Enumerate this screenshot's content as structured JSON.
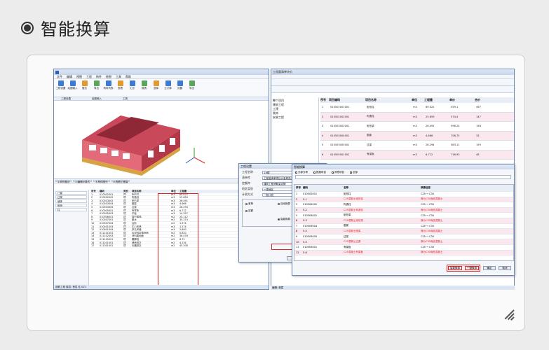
{
  "header": {
    "title": "智能换算"
  },
  "left_window": {
    "menu": [
      "文件",
      "编辑",
      "视图",
      "工程",
      "构件",
      "绘图",
      "工具",
      "帮助"
    ],
    "ribbon": [
      "工程设置",
      "绘图输入",
      "做法",
      "导出",
      "构件列表",
      "查看",
      "汇总",
      "报表",
      "选择",
      "云计算",
      "设置",
      "导出"
    ],
    "groups": [
      "工程设置",
      "绘图输入",
      "工具"
    ],
    "tabs": [
      "1.构件做法",
      "2.编辑计算式",
      "3.构件图元",
      "4.查看工程量"
    ],
    "tree": [
      "门窗",
      "过梁",
      "墙体",
      "砌块",
      "柱"
    ],
    "grid_header": [
      "序号",
      "编码",
      "类别",
      "项目名称",
      "单位",
      "工程量"
    ],
    "grid_rows": [
      [
        "1",
        "010502001",
        "项",
        "矩形柱",
        "m3",
        "89.022"
      ],
      [
        "2",
        "010502002",
        "项",
        "构造柱",
        "m3",
        "25.659"
      ],
      [
        "3",
        "010503002",
        "项",
        "矩形梁",
        "m3",
        "26.491"
      ],
      [
        "4",
        "010503004",
        "项",
        "圈梁",
        "m3",
        "4.666"
      ],
      [
        "5",
        "010503005",
        "项",
        "过梁",
        "m3",
        "28.294"
      ],
      [
        "6",
        "010505001",
        "项",
        "有梁板",
        "m3",
        "6.712"
      ],
      [
        "7",
        "010505003",
        "项",
        "平板",
        "m3",
        "14.357"
      ],
      [
        "8",
        "010506001",
        "项",
        "直形楼梯",
        "m2",
        "20.112"
      ],
      [
        "9",
        "010507001",
        "项",
        "散水",
        "m2",
        "35.274"
      ],
      [
        "10",
        "010507004",
        "项",
        "台阶",
        "m2",
        "1.574"
      ],
      [
        "11",
        "010401003",
        "项",
        "实心砖墙",
        "m3",
        "1.274"
      ],
      [
        "12",
        "010401004",
        "项",
        "多孔砖墙",
        "m3",
        "2.600"
      ],
      [
        "13",
        "011101001",
        "项",
        "水泥砂浆楼地面",
        "m2",
        "0.820"
      ],
      [
        "14",
        "011102003",
        "项",
        "块料楼地面",
        "m2",
        "36.476"
      ],
      [
        "15",
        "011105001",
        "项",
        "踢脚线",
        "m2",
        "8.72"
      ],
      [
        "16",
        "011201001",
        "项",
        "墙面抹灰",
        "m2",
        "4.134"
      ],
      [
        "17",
        "011301001",
        "项",
        "天棚抹灰",
        "m2",
        "45.208"
      ]
    ],
    "status": "钢筋工程 楼层: 首层  柱  KZ1"
  },
  "right_window": {
    "title": "工程量清单计价",
    "tree": [
      "整个项目",
      "建筑工程",
      "土建",
      "装饰",
      "安装工程"
    ],
    "grid_header": [
      "序号",
      "项目编码",
      "项目名称",
      "单位",
      "工程量",
      "单价",
      "合价"
    ],
    "grid_rows": [
      [
        "1",
        "010502001001",
        "矩形柱",
        "m3",
        "89.022",
        "559.1",
        "497"
      ],
      [
        "2",
        "010502002001",
        "构造柱",
        "m3",
        "25.659",
        "574.4",
        "147"
      ],
      [
        "3",
        "010503002001",
        "矩形梁",
        "m3",
        "26.491",
        "596.24",
        "158"
      ],
      [
        "4",
        "010503004001",
        "圈梁",
        "m3",
        "4.666",
        "708.75",
        "33"
      ],
      [
        "5",
        "010503005001",
        "过梁",
        "m3",
        "28.294",
        "563.11",
        "159"
      ],
      [
        "6",
        "010505001001",
        "有梁板",
        "m3",
        "6.712",
        "716.93",
        "48"
      ]
    ],
    "status": "编辑: 首层"
  },
  "dialog_1": {
    "title": "工程设置",
    "fields": [
      {
        "label": "工程名称",
        "value": "1#楼"
      },
      {
        "label": "清单库",
        "value": "工程量清单项目计量规范(2013)"
      },
      {
        "label": "定额库",
        "value": "建筑工程消耗量定额"
      },
      {
        "label": "地区类别",
        "value": "一类地区"
      },
      {
        "label": "计税方式",
        "value": "一般计税"
      }
    ],
    "options": [
      "清单",
      "定额",
      "自动换算",
      "智能换算"
    ],
    "buttons": [
      "确定",
      "取消"
    ]
  },
  "dialog_2": {
    "title": "智能换算",
    "filters": [
      "分部分项",
      "措施项目",
      "其他项目",
      "全部"
    ],
    "table_header": [
      "序号",
      "编码",
      "名称",
      "换算信息"
    ],
    "table_rows": [
      [
        "1",
        "010502001",
        "矩形柱",
        "C25 → C30"
      ],
      [
        "2",
        "5-1",
        "C25混凝土矩形柱",
        "换为C30商品混凝土"
      ],
      [
        "3",
        "010502002",
        "构造柱",
        "C25 → C30"
      ],
      [
        "4",
        "5-2",
        "C25混凝土构造柱",
        "换为C30商品混凝土"
      ],
      [
        "5",
        "010503002",
        "矩形梁",
        "C25 → C30"
      ],
      [
        "6",
        "5-3",
        "C25混凝土矩形梁",
        "换为C30商品混凝土"
      ],
      [
        "7",
        "010503004",
        "圈梁",
        "C25 → C30"
      ],
      [
        "8",
        "5-4",
        "C25混凝土圈梁",
        "换为C30商品混凝土"
      ],
      [
        "9",
        "010503005",
        "过梁",
        "C25 → C30"
      ],
      [
        "10",
        "5-5",
        "C25混凝土过梁",
        "换为C30商品混凝土"
      ],
      [
        "11",
        "010505001",
        "有梁板",
        "C25 → C30"
      ],
      [
        "12",
        "5-6",
        "C25混凝土有梁板",
        "换为C30商品混凝土"
      ]
    ],
    "buttons": [
      "智能换算",
      "一键换算",
      "确定",
      "取消"
    ]
  }
}
